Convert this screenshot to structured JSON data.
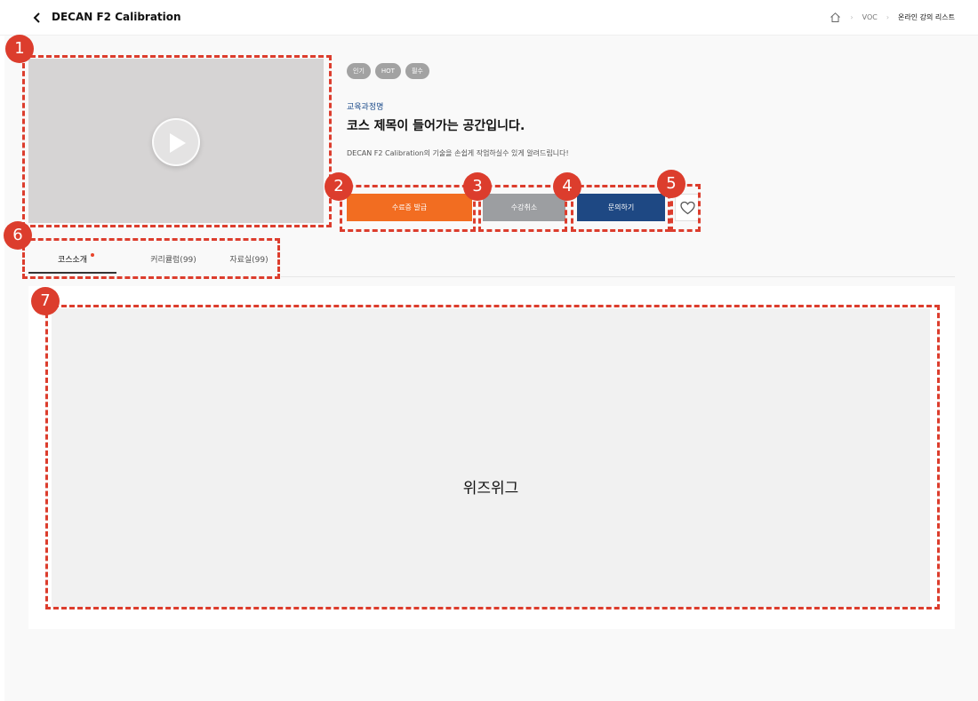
{
  "header": {
    "title": "DECAN F2 Calibration",
    "breadcrumb": [
      "VOC",
      "온라인 강의 리스트"
    ]
  },
  "course": {
    "badges": [
      "인기",
      "HOT",
      "필수"
    ],
    "category": "교육과정명",
    "title": "코스 제목이 들어가는 공간입니다.",
    "description": "DECAN F2 Calibration의 기술을 손쉽게 작업하실수 있게 알려드립니다!"
  },
  "actions": {
    "certificate": "수료증 발급",
    "cancel": "수강취소",
    "inquiry": "문의하기"
  },
  "tabs": {
    "intro": "코스소개",
    "curriculum": "커리큘럼(99)",
    "resources": "자료실(99)"
  },
  "editor": {
    "label": "위즈위그"
  },
  "annotations": [
    "1",
    "2",
    "3",
    "4",
    "5",
    "6",
    "7"
  ],
  "colors": {
    "accent_orange": "#f26d21",
    "navy": "#1e4883",
    "annotation_red": "#dc3d2d"
  }
}
